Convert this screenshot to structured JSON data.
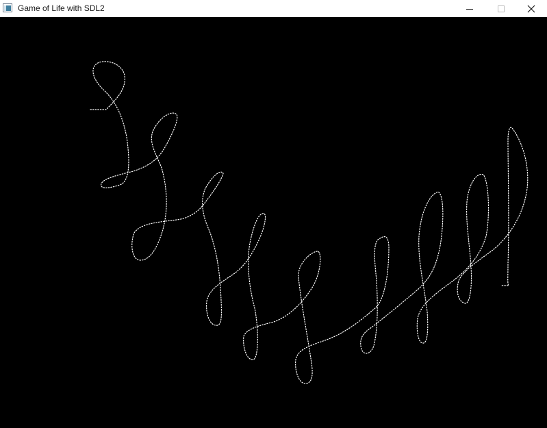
{
  "window": {
    "title": "Game of Life with SDL2",
    "app_icon": "sdl-window-icon",
    "controls": {
      "minimize_icon": "minimize-icon",
      "maximize_icon": "maximize-icon",
      "close_icon": "close-icon"
    }
  },
  "canvas": {
    "background_color": "#000000",
    "cell_color": "#ffffff",
    "content": "dotted-handwritten-curve-cells"
  }
}
